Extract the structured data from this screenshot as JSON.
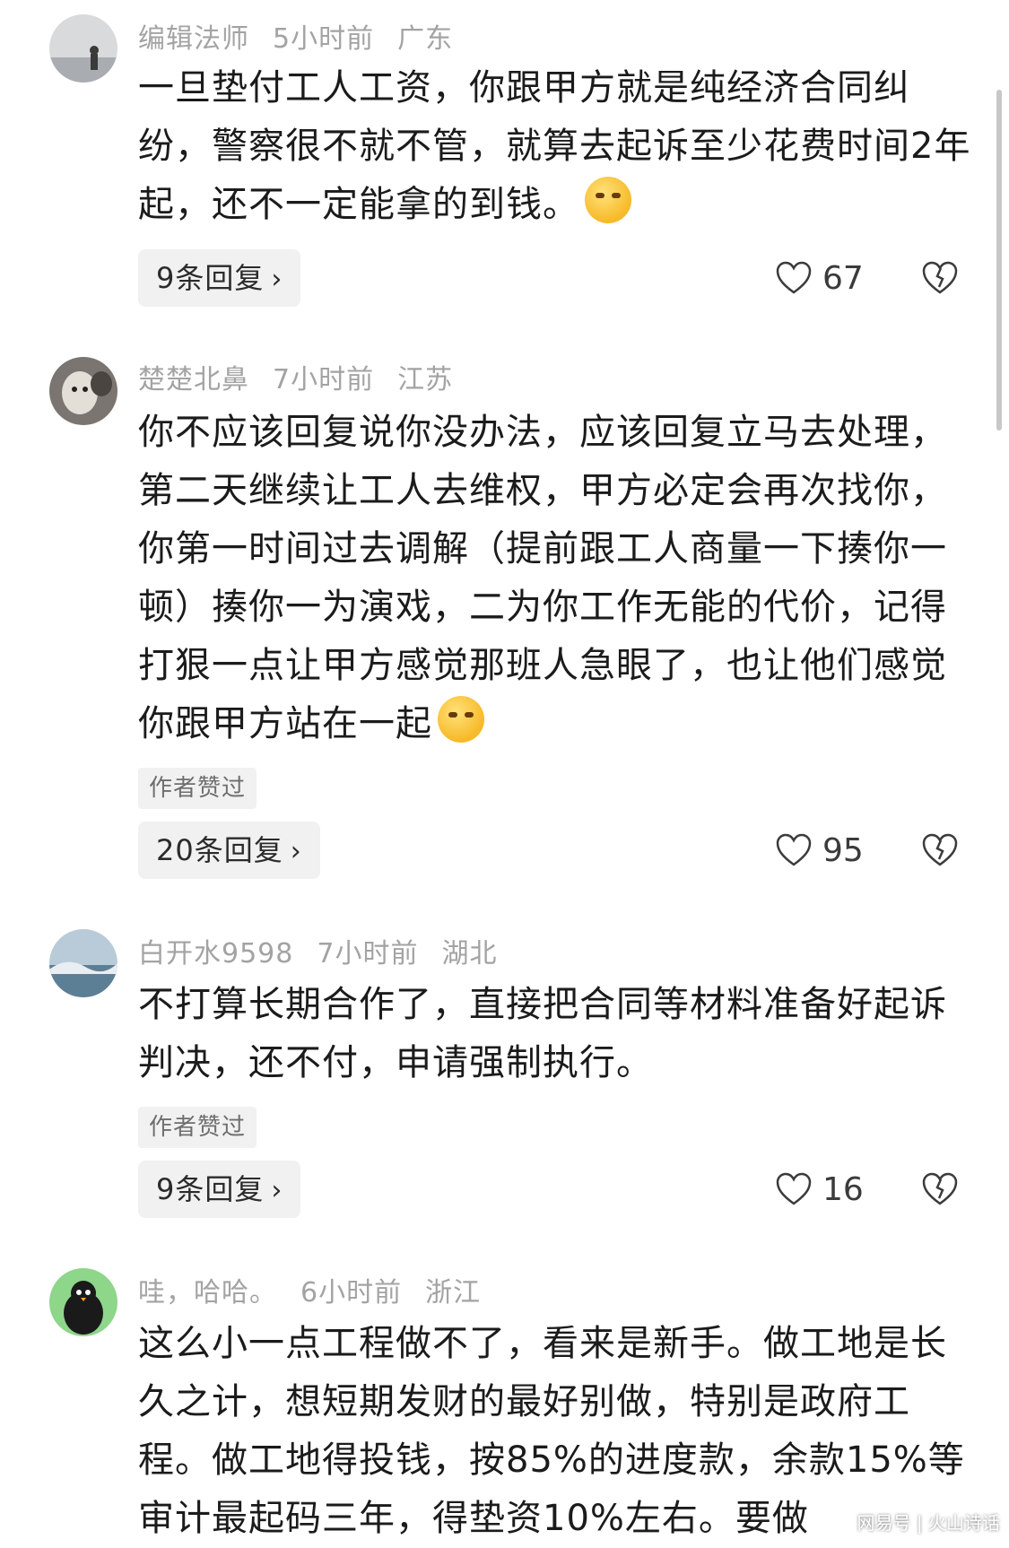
{
  "comments": [
    {
      "username": "编辑法师",
      "time": "5小时前",
      "location": "广东",
      "text": "一旦垫付工人工资，你跟甲方就是纯经济合同纠纷，警察很不就不管，就算去起诉至少花费时间2年起，还不一定能拿的到钱。",
      "emoji": "smirk-emoji",
      "author_liked": "",
      "replies": "9条回复",
      "likes": "67"
    },
    {
      "username": "楚楚北鼻",
      "time": "7小时前",
      "location": "江苏",
      "text": "你不应该回复说你没办法，应该回复立马去处理，第二天继续让工人去维权，甲方必定会再次找你，你第一时间过去调解（提前跟工人商量一下揍你一顿）揍你一为演戏，二为你工作无能的代价，记得打狠一点让甲方感觉那班人急眼了，也让他们感觉你跟甲方站在一起",
      "emoji": "laugh-cry-emoji",
      "author_liked": "作者赞过",
      "replies": "20条回复",
      "likes": "95"
    },
    {
      "username": "白开水9598",
      "time": "7小时前",
      "location": "湖北",
      "text": "不打算长期合作了，直接把合同等材料准备好起诉判决，还不付，申请强制执行。",
      "author_liked": "作者赞过",
      "replies": "9条回复",
      "likes": "16"
    },
    {
      "username": "哇，哈哈。",
      "time": "6小时前",
      "location": "浙江",
      "text": "这么小一点工程做不了，看来是新手。做工地是长久之计，想短期发财的最好别做，特别是政府工程。做工地得投钱，按85%的进度款，余款15%等审计最起码三年，得垫资10%左右。要做"
    }
  ],
  "watermark": "网易号 | 火山诗话",
  "colors": {
    "meta": "#a3a3a3",
    "text": "#1b1b1b",
    "chip_bg": "#f1f1f1"
  }
}
